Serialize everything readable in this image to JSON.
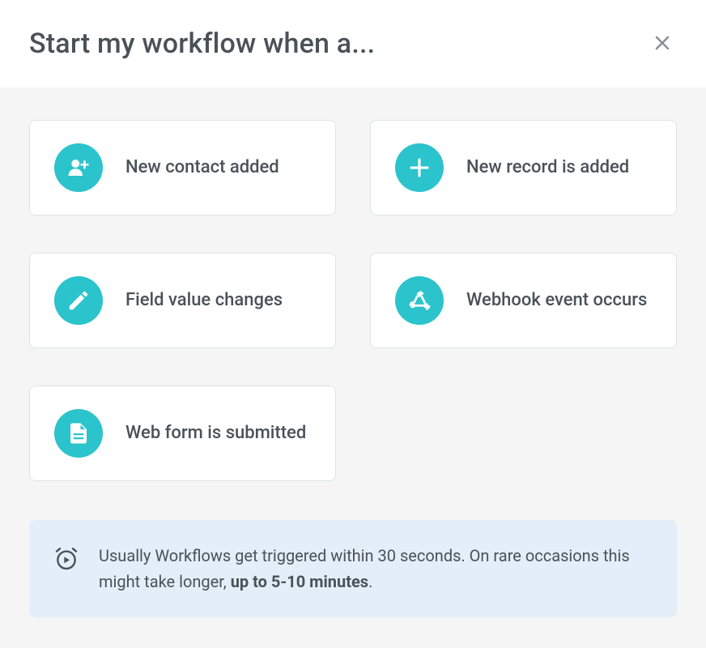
{
  "header": {
    "title": "Start my workflow when a..."
  },
  "triggers": [
    {
      "icon": "person-add",
      "label": "New contact added"
    },
    {
      "icon": "plus",
      "label": "New record is added"
    },
    {
      "icon": "pencil",
      "label": "Field value changes"
    },
    {
      "icon": "webhook",
      "label": "Webhook event occurs"
    },
    {
      "icon": "form",
      "label": "Web form is submitted"
    }
  ],
  "info": {
    "text_prefix": "Usually Workflows get triggered within 30 seconds. On rare occasions this might take longer, ",
    "text_bold": "up to 5-10 minutes",
    "text_suffix": "."
  }
}
